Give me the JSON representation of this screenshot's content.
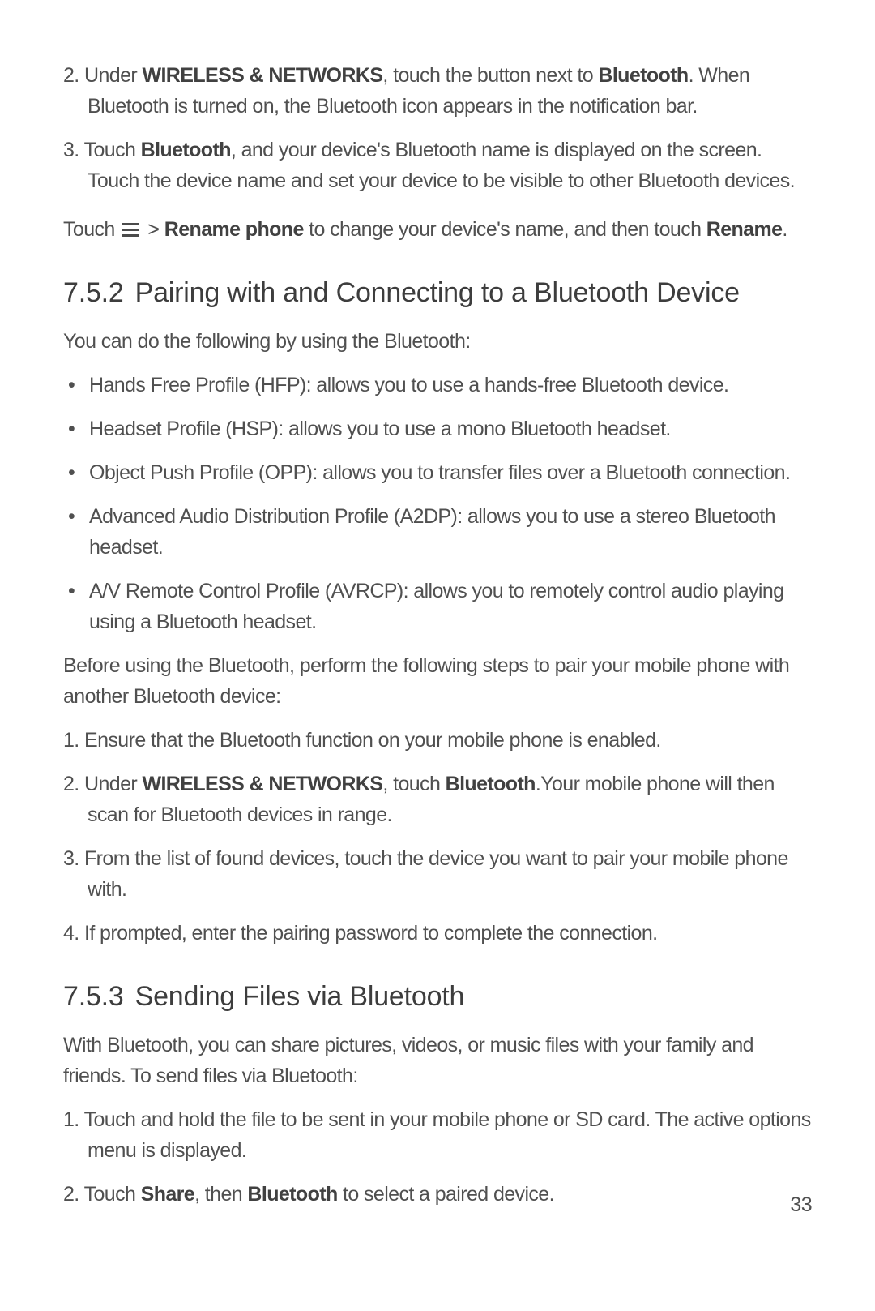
{
  "list1": {
    "item2": {
      "num": "2.",
      "t1": "Under ",
      "b1": "WIRELESS & NETWORKS",
      "t2": ", touch the button next to ",
      "b2": "Bluetooth",
      "t3": ". When Bluetooth is turned on, the Bluetooth icon appears in the notification bar."
    },
    "item3": {
      "num": "3.",
      "t1": "Touch ",
      "b1": "Bluetooth",
      "t2": ", and your device's Bluetooth name is displayed on the screen. Touch the device name and set your device to be visible to other Bluetooth devices."
    }
  },
  "rename": {
    "t1": "Touch ",
    "t2": " > ",
    "b1": "Rename phone",
    "t3": " to change your device's name, and then touch ",
    "b2": "Rename",
    "t4": "."
  },
  "h752": {
    "num": "7.5.2",
    "title": "Pairing with and Connecting to a Bluetooth Device"
  },
  "intro752": "You can do the following by using the Bluetooth:",
  "bullets": {
    "b1": "Hands Free Profile (HFP): allows you to use a hands-free Bluetooth device.",
    "b2": "Headset Profile (HSP): allows you to use a mono Bluetooth headset.",
    "b3": "Object Push Profile (OPP): allows you to transfer files over a Bluetooth connection.",
    "b4": "Advanced Audio Distribution Profile (A2DP): allows you to use a stereo Bluetooth headset.",
    "b5": "A/V Remote Control Profile (AVRCP): allows you to remotely control audio playing using a Bluetooth headset."
  },
  "before": "Before using the Bluetooth, perform the following steps to pair your mobile phone with another Bluetooth device:",
  "list2": {
    "item1": {
      "num": "1.",
      "text": "Ensure that the Bluetooth function on your mobile phone is enabled."
    },
    "item2": {
      "num": "2.",
      "t1": "Under ",
      "b1": "WIRELESS & NETWORKS",
      "t2": ", touch ",
      "b2": "Bluetooth",
      "t3": ".Your mobile phone will then scan for Bluetooth devices in range."
    },
    "item3": {
      "num": "3.",
      "text": "From the list of found devices, touch the device you want to pair your mobile phone with."
    },
    "item4": {
      "num": "4.",
      "text": "If prompted, enter the pairing password to complete the connection."
    }
  },
  "h753": {
    "num": "7.5.3",
    "title": "Sending Files via Bluetooth"
  },
  "intro753": "With Bluetooth, you can share pictures, videos, or music files with your family and friends. To send files via Bluetooth:",
  "list3": {
    "item1": {
      "num": "1.",
      "text": "Touch and hold the file to be sent in your mobile phone or SD card. The active options menu is displayed."
    },
    "item2": {
      "num": "2.",
      "t1": "Touch ",
      "b1": "Share",
      "t2": ", then ",
      "b2": "Bluetooth",
      "t3": " to select a paired device."
    }
  },
  "pageNumber": "33"
}
